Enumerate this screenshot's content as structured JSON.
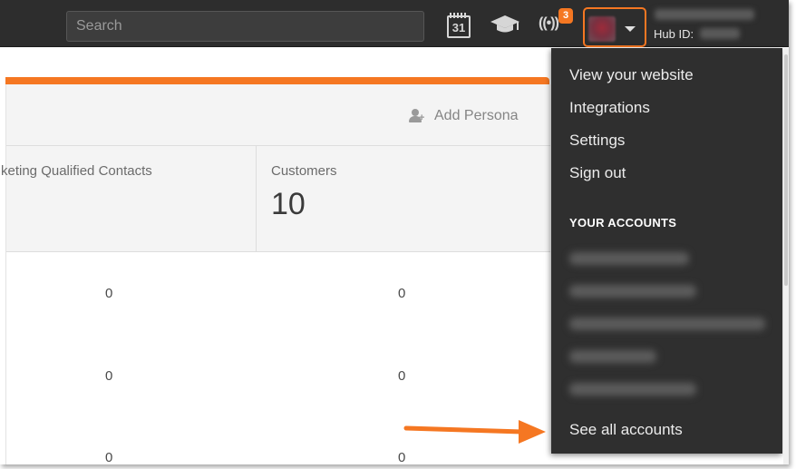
{
  "nav": {
    "search_placeholder": "Search",
    "calendar_day": "31",
    "notification_count": "3",
    "hub_id_label": "Hub ID:"
  },
  "card": {
    "add_persona_label": "Add Persona",
    "stats": [
      {
        "label": "keting Qualified Contacts",
        "value": ""
      },
      {
        "label": "Customers",
        "value": "10"
      }
    ],
    "rows": [
      [
        "0",
        "0"
      ],
      [
        "0",
        "0"
      ],
      [
        "0",
        "0"
      ]
    ]
  },
  "dropdown": {
    "items": [
      "View your website",
      "Integrations",
      "Settings",
      "Sign out"
    ],
    "section_title": "YOUR ACCOUNTS",
    "see_all_label": "See all accounts"
  },
  "colors": {
    "accent": "#f57722",
    "nav_bg": "#2d2d2d",
    "dropdown_bg": "#2f2f2f"
  },
  "icons": [
    "calendar-icon",
    "graduation-cap-icon",
    "broadcast-icon",
    "chevron-down-icon",
    "add-person-icon",
    "arrow-annotation-icon"
  ]
}
